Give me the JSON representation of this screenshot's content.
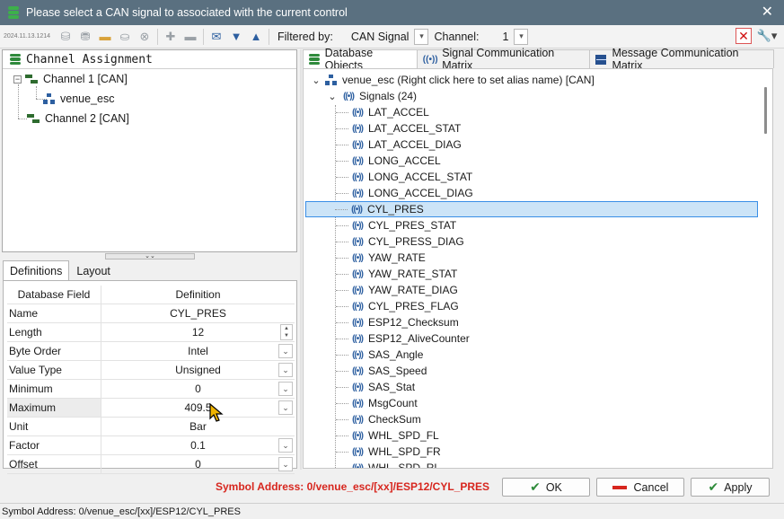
{
  "window": {
    "title": "Please select a CAN signal to associated with the current control",
    "close_glyph": "✕"
  },
  "toolbar": {
    "date_stamp": "2024.11.13.1214",
    "filtered_by_label": "Filtered by:",
    "filter_value": "CAN Signal",
    "channel_label": "Channel:",
    "channel_value": "1",
    "icons": [
      "add-database-icon",
      "add-node-icon",
      "open-folder-icon",
      "remove-database-icon",
      "clear-icon",
      "plus-icon",
      "minus-icon",
      "message-icon",
      "arrow-down-icon",
      "arrow-up-icon",
      "delete-icon",
      "wrench-icon"
    ],
    "colors": {
      "accent_blue": "#2d5fa0",
      "delete_red": "#d01010"
    }
  },
  "channel_assignment": {
    "header": "Channel Assignment",
    "items": [
      {
        "label": "Channel 1 [CAN]",
        "expander": "−"
      },
      {
        "label": "venue_esc"
      },
      {
        "label": "Channel 2 [CAN]"
      }
    ]
  },
  "definitions": {
    "tabs": [
      "Definitions",
      "Layout"
    ],
    "columns": [
      "Database Field",
      "Definition"
    ],
    "rows": [
      {
        "field": "Name",
        "value": "CYL_PRES"
      },
      {
        "field": "Length",
        "value": "12"
      },
      {
        "field": "Byte Order",
        "value": "Intel"
      },
      {
        "field": "Value Type",
        "value": "Unsigned"
      },
      {
        "field": "Minimum",
        "value": "0"
      },
      {
        "field": "Maximum",
        "value": "409.5"
      },
      {
        "field": "Unit",
        "value": "Bar"
      },
      {
        "field": "Factor",
        "value": "0.1"
      },
      {
        "field": "Offset",
        "value": "0"
      }
    ]
  },
  "right_panel": {
    "tabs": [
      "Database Objects",
      "Signal Communication Matrix",
      "Message Communication Matrix"
    ],
    "root": "venue_esc (Right click here to set alias name) [CAN]",
    "signals_group": "Signals (24)",
    "selected_signal": "CYL_PRES",
    "signals": [
      "LAT_ACCEL",
      "LAT_ACCEL_STAT",
      "LAT_ACCEL_DIAG",
      "LONG_ACCEL",
      "LONG_ACCEL_STAT",
      "LONG_ACCEL_DIAG",
      "CYL_PRES",
      "CYL_PRES_STAT",
      "CYL_PRESS_DIAG",
      "YAW_RATE",
      "YAW_RATE_STAT",
      "YAW_RATE_DIAG",
      "CYL_PRES_FLAG",
      "ESP12_Checksum",
      "ESP12_AliveCounter",
      "SAS_Angle",
      "SAS_Speed",
      "SAS_Stat",
      "MsgCount",
      "CheckSum",
      "WHL_SPD_FL",
      "WHL_SPD_FR",
      "WHL_SPD_RL"
    ]
  },
  "footer": {
    "symbol_address": "Symbol Address: 0/venue_esc/[xx]/ESP12/CYL_PRES",
    "ok_label": "OK",
    "cancel_label": "Cancel",
    "apply_label": "Apply"
  },
  "status_bar": {
    "text": "Symbol Address: 0/venue_esc/[xx]/ESP12/CYL_PRES"
  }
}
